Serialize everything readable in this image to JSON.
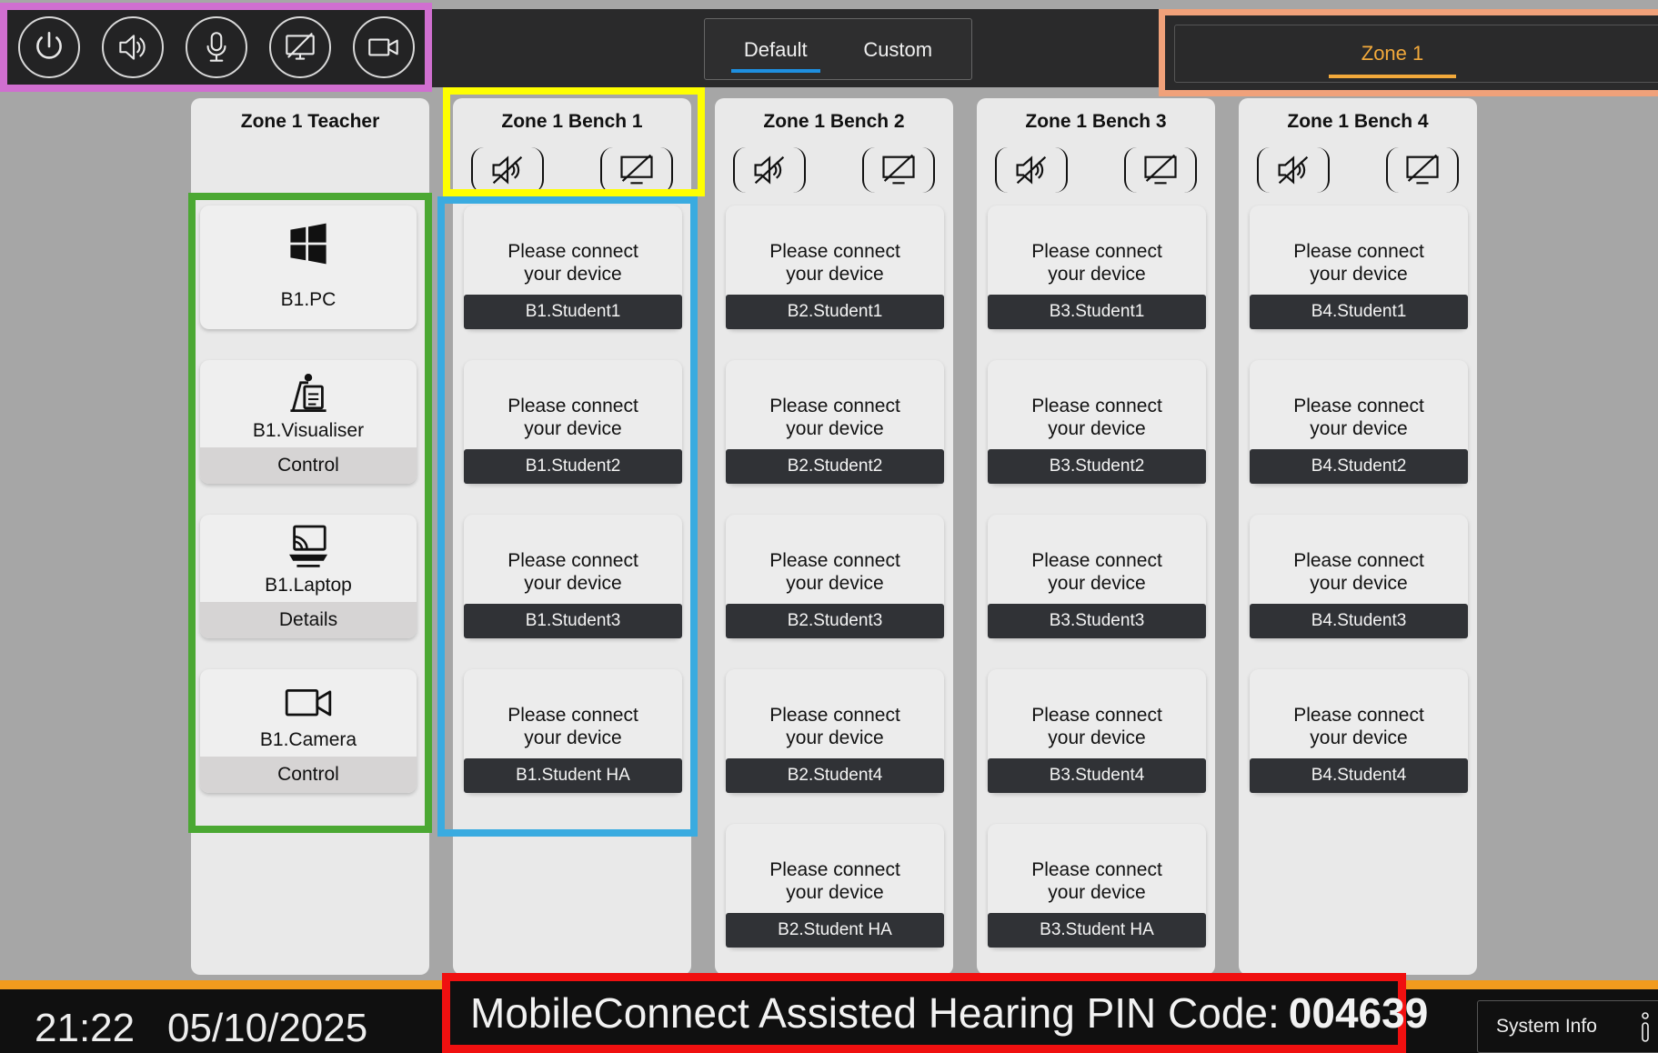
{
  "header": {
    "toolbar": [
      {
        "name": "power-icon"
      },
      {
        "name": "speaker-icon"
      },
      {
        "name": "microphone-icon"
      },
      {
        "name": "display-off-icon"
      },
      {
        "name": "camera-icon"
      }
    ],
    "mode_tabs": {
      "default": "Default",
      "custom": "Custom",
      "active": "Default"
    },
    "zone_tab": "Zone 1",
    "accent_color": "#f2a93b",
    "tab_underline_color": "#1e8fe0"
  },
  "teacher": {
    "title": "Zone 1 Teacher",
    "sources": [
      {
        "name": "B1.PC",
        "icon": "windows-icon",
        "action": ""
      },
      {
        "name": "B1.Visualiser",
        "icon": "visualiser-icon",
        "action": "Control"
      },
      {
        "name": "B1.Laptop",
        "icon": "laptop-cast-icon",
        "action": "Details"
      },
      {
        "name": "B1.Camera",
        "icon": "camera-icon",
        "action": "Control"
      }
    ]
  },
  "benches": [
    {
      "title": "Zone 1 Bench 1",
      "devices": [
        {
          "msg": "Please connect your device",
          "label": "B1.Student1"
        },
        {
          "msg": "Please connect your device",
          "label": "B1.Student2"
        },
        {
          "msg": "Please connect your device",
          "label": "B1.Student3"
        },
        {
          "msg": "Please connect your device",
          "label": "B1.Student HA"
        }
      ]
    },
    {
      "title": "Zone 1 Bench 2",
      "devices": [
        {
          "msg": "Please connect your device",
          "label": "B2.Student1"
        },
        {
          "msg": "Please connect your device",
          "label": "B2.Student2"
        },
        {
          "msg": "Please connect your device",
          "label": "B2.Student3"
        },
        {
          "msg": "Please connect your device",
          "label": "B2.Student4"
        },
        {
          "msg": "Please connect your device",
          "label": "B2.Student HA"
        }
      ]
    },
    {
      "title": "Zone 1 Bench 3",
      "devices": [
        {
          "msg": "Please connect your device",
          "label": "B3.Student1"
        },
        {
          "msg": "Please connect your device",
          "label": "B3.Student2"
        },
        {
          "msg": "Please connect your device",
          "label": "B3.Student3"
        },
        {
          "msg": "Please connect your device",
          "label": "B3.Student4"
        },
        {
          "msg": "Please connect your device",
          "label": "B3.Student HA"
        }
      ]
    },
    {
      "title": "Zone 1 Bench 4",
      "devices": [
        {
          "msg": "Please connect your device",
          "label": "B4.Student1"
        },
        {
          "msg": "Please connect your device",
          "label": "B4.Student2"
        },
        {
          "msg": "Please connect your device",
          "label": "B4.Student3"
        },
        {
          "msg": "Please connect your device",
          "label": "B4.Student4"
        }
      ]
    }
  ],
  "footer": {
    "time": "21:22",
    "date": "05/10/2025",
    "pin_label": "MobileConnect Assisted Hearing PIN Code:",
    "pin_code": "004639",
    "system_info": "System Info"
  }
}
